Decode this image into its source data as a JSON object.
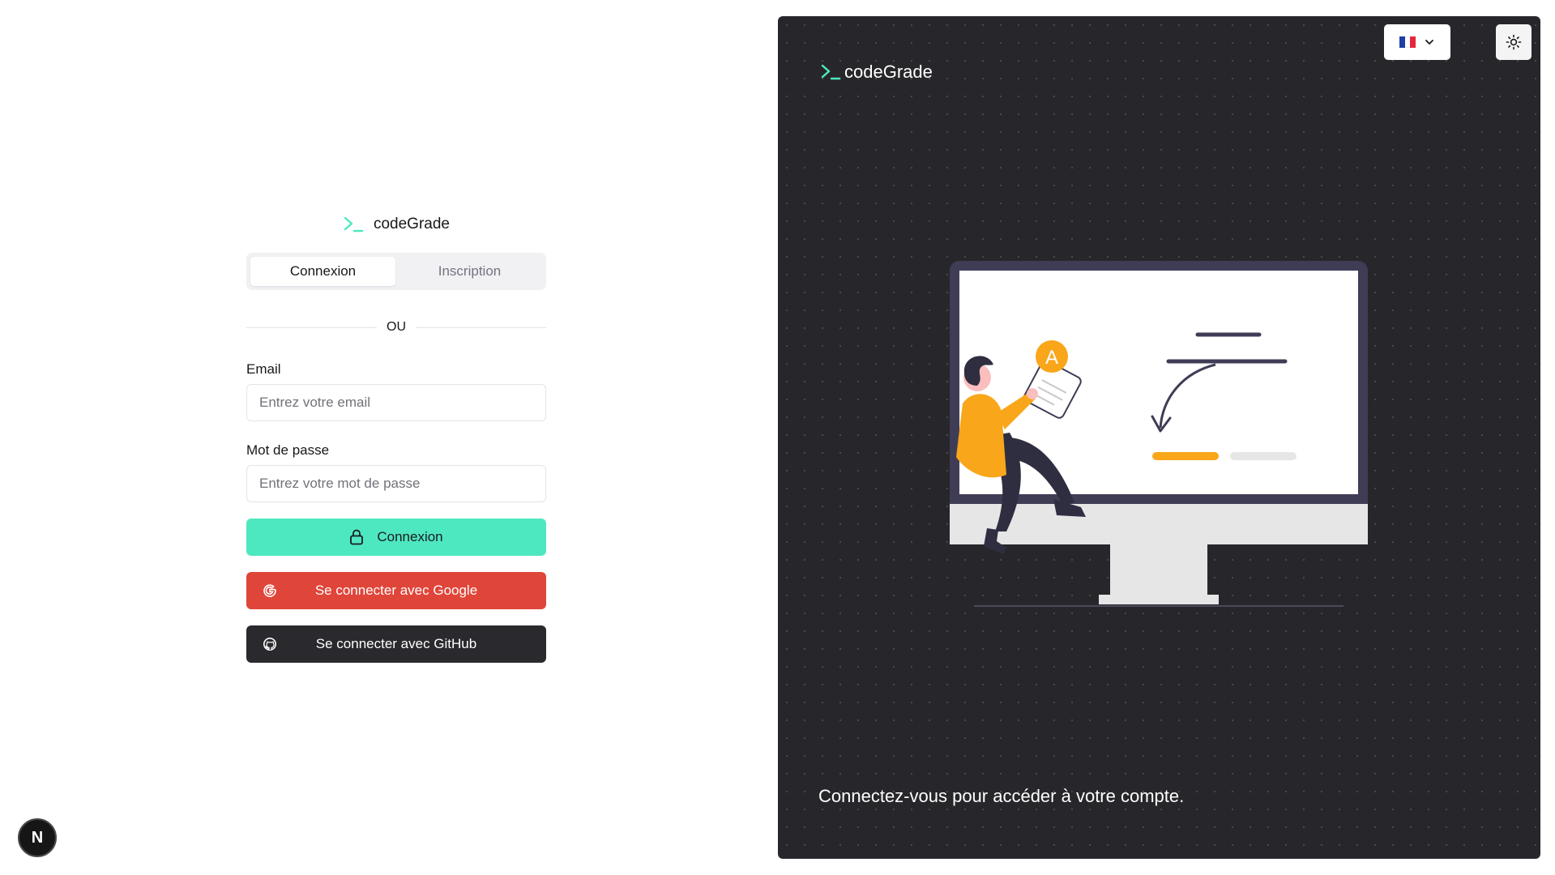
{
  "brand": {
    "name": "codeGrade",
    "accent": "#4ee8c0"
  },
  "tabs": [
    {
      "label": "Connexion",
      "active": true
    },
    {
      "label": "Inscription",
      "active": false
    }
  ],
  "divider_label": "OU",
  "email": {
    "label": "Email",
    "placeholder": "Entrez votre email",
    "value": ""
  },
  "password": {
    "label": "Mot de passe",
    "placeholder": "Entrez votre mot de passe",
    "value": ""
  },
  "buttons": {
    "login": {
      "label": "Connexion",
      "icon": "lock-icon",
      "color": "#4ee8c0"
    },
    "google": {
      "label": "Se connecter avec Google",
      "icon": "google-icon",
      "color": "#e0453a"
    },
    "github": {
      "label": "Se connecter avec GitHub",
      "icon": "github-icon",
      "color": "#2a2a2e"
    }
  },
  "dev_badge": {
    "letter": "N"
  },
  "hero": {
    "brand_name": "codeGrade",
    "caption": "Connectez-vous pour accéder à votre compte.",
    "language_icon": "france-flag-icon",
    "theme_icon": "sun-icon",
    "illustration_grade": "A",
    "background": "#27272b"
  }
}
